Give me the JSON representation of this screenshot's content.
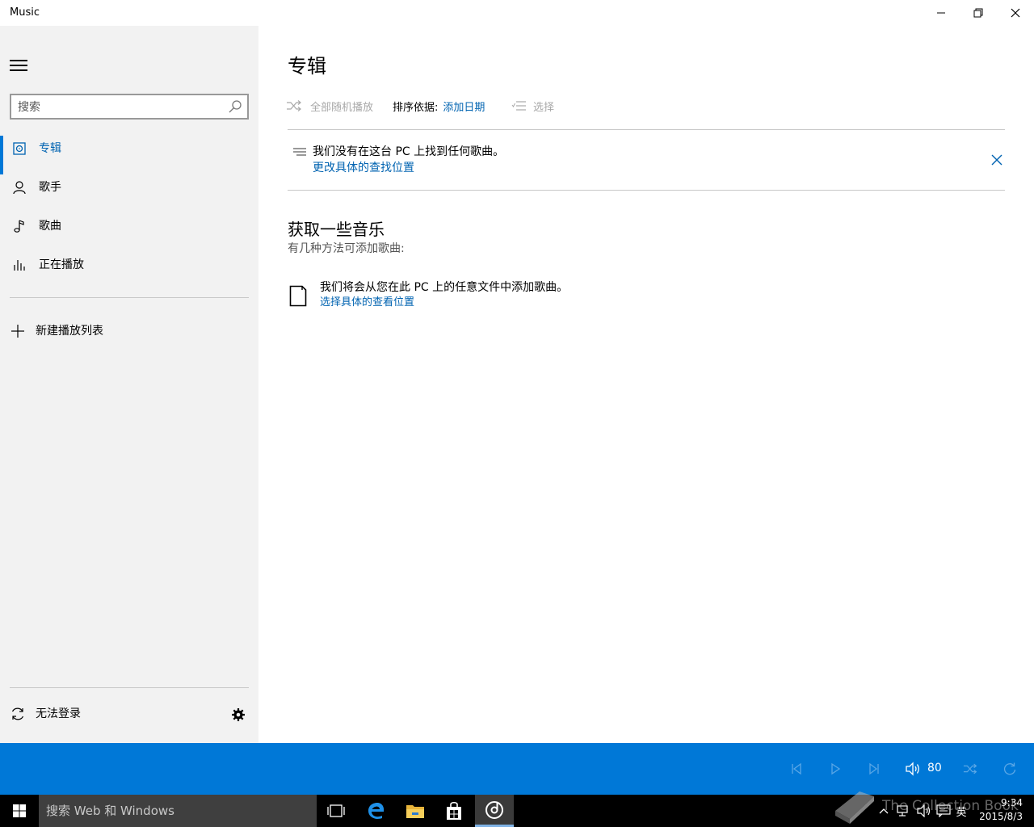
{
  "window": {
    "title": "Music",
    "minimize_icon": "minimize-icon",
    "maximize_icon": "restore-icon",
    "close_icon": "close-icon"
  },
  "sidebar": {
    "menu_icon": "hamburger-icon",
    "search": {
      "placeholder": "搜索",
      "value": ""
    },
    "items": [
      {
        "label": "专辑",
        "icon": "album-icon",
        "active": true
      },
      {
        "label": "歌手",
        "icon": "person-icon",
        "active": false
      },
      {
        "label": "歌曲",
        "icon": "music-note-icon",
        "active": false
      },
      {
        "label": "正在播放",
        "icon": "equalizer-icon",
        "active": false
      }
    ],
    "new_playlist": "新建播放列表",
    "signin": "无法登录",
    "settings_icon": "gear-icon"
  },
  "main": {
    "title": "专辑",
    "commands": {
      "shuffle": "全部随机播放",
      "sort_label": "排序依据:",
      "sort_value": "添加日期",
      "select": "选择"
    },
    "notice": {
      "text": "我们没有在这台 PC 上找到任何歌曲。",
      "link": "更改具体的查找位置"
    },
    "section": {
      "title": "获取一些音乐",
      "subtitle": "有几种方法可添加歌曲:",
      "file_text": "我们将会从您在此 PC 上的任意文件中添加歌曲。",
      "file_link": "选择具体的查看位置"
    }
  },
  "player": {
    "volume": "80",
    "accent": "#0078d7"
  },
  "taskbar": {
    "search_text": "搜索 Web 和 Windows",
    "ime": "英",
    "time": "9:34",
    "date": "2015/8/3",
    "watermark": "The Collection Book"
  }
}
